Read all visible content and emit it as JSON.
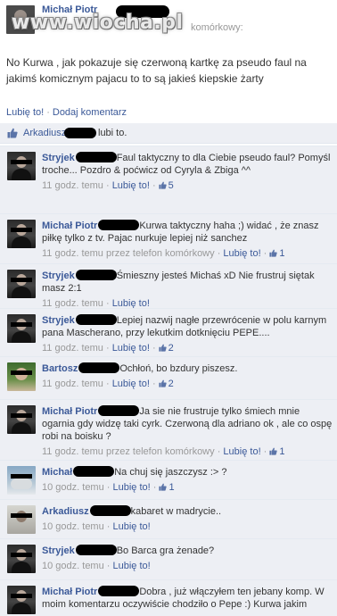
{
  "header": {
    "author": "Michał Piotr",
    "via": "komórkowy:",
    "watermark": "www.wiocha.pl"
  },
  "post": {
    "text": "No Kurwa , jak pokazuje się czerwoną kartkę za pseudo faul na jakimś komicznym pajacu to to są jakieś kiepskie żarty"
  },
  "actions": {
    "like": "Lubię to!",
    "separator": "·",
    "comment": "Dodaj komentarz"
  },
  "likes": {
    "name": "Arkadiusz",
    "suffix": "lubi to."
  },
  "comments": [
    {
      "name": "Stryjek",
      "text": "Faul taktyczny to dla Ciebie pseudo faul? Pomyśl troche... Pozdro & poćwicz od Cyryla & Zbiga ^^",
      "time": "11 godz. temu",
      "via": "",
      "like_label": "Lubię to!",
      "likes": "5",
      "avatar": "dark"
    },
    {
      "name": "Michał Piotr",
      "text": "Kurwa taktyczny haha ;) widać , że znasz piłkę tylko z tv. Pajac nurkuje lepiej niż sanchez",
      "time": "11 godz. temu",
      "via": "przez telefon komórkowy",
      "like_label": "Lubię to!",
      "likes": "1",
      "avatar": "dark"
    },
    {
      "name": "Stryjek",
      "text": "Śmieszny jesteś Michaś xD Nie frustruj siętak masz 2:1",
      "time": "11 godz. temu",
      "via": "",
      "like_label": "Lubię to!",
      "likes": "",
      "avatar": "dark"
    },
    {
      "name": "Stryjek",
      "text": "Lepiej nazwij nagłe przewrócenie w polu karnym pana Mascherano, przy lekutkim dotknięciu PEPE....",
      "time": "11 godz. temu",
      "via": "",
      "like_label": "Lubię to!",
      "likes": "2",
      "avatar": "dark"
    },
    {
      "name": "Bartosz",
      "text": "Ochłoń, bo bzdury piszesz.",
      "time": "11 godz. temu",
      "via": "",
      "like_label": "Lubię to!",
      "likes": "2",
      "avatar": "green"
    },
    {
      "name": "Michał Piotr",
      "text": "Ja sie nie frustruje tylko śmiech mnie ogarnia gdy widzę taki cyrk. Czerwoną dla adriano ok , ale co ospę robi na boisku ?",
      "time": "11 godz. temu",
      "via": "przez telefon komórkowy",
      "like_label": "Lubię to!",
      "likes": "1",
      "avatar": "dark"
    },
    {
      "name": "Michał",
      "text": "Na chuj się jaszczysz :> ?",
      "time": "10 godz. temu",
      "via": "",
      "like_label": "Lubię to!",
      "likes": "1",
      "avatar": "blue"
    },
    {
      "name": "Arkadiusz",
      "text": "kabaret w madrycie..",
      "time": "10 godz. temu",
      "via": "",
      "like_label": "Lubię to!",
      "likes": "",
      "avatar": "light"
    },
    {
      "name": "Stryjek",
      "text": "Bo Barca gra żenade?",
      "time": "10 godz. temu",
      "via": "",
      "like_label": "Lubię to!",
      "likes": "",
      "avatar": "dark"
    },
    {
      "name": "Michał Piotr",
      "text": "Dobra , już włączyłem ten jebany komp. W moim komentarzu oczywiście chodziło o Pepe :) Kurwa jakim",
      "time": "",
      "via": "",
      "like_label": "",
      "likes": "",
      "avatar": "dark"
    }
  ],
  "colors": {
    "link": "#3b5998",
    "comment_bg": "#edeff4",
    "meta": "#999999"
  },
  "icons": {
    "like": "thumbs-up-icon"
  }
}
